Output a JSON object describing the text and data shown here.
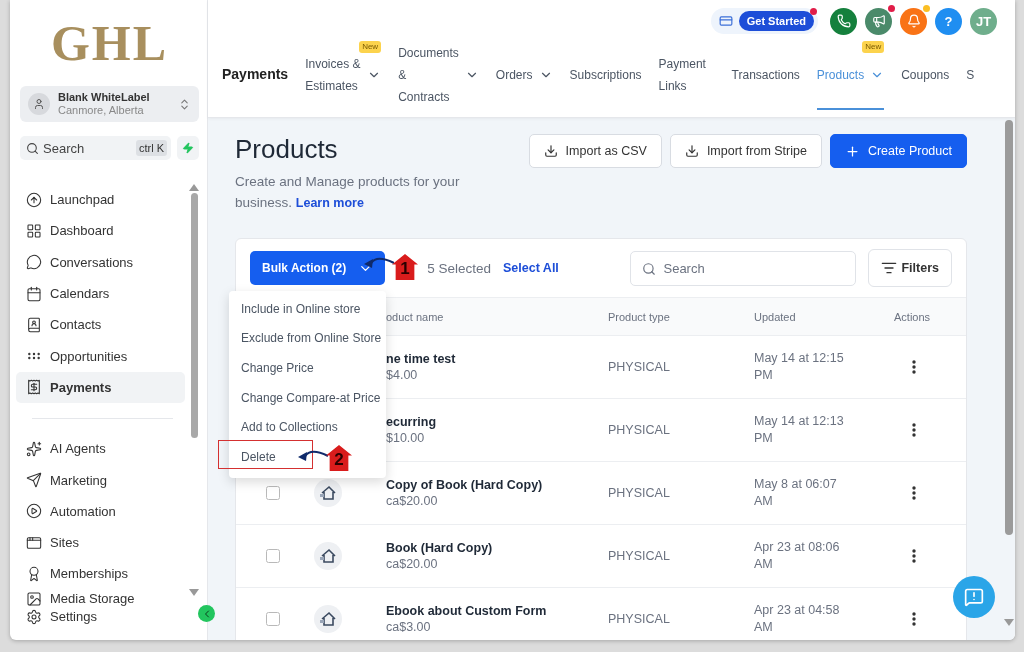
{
  "sidebar": {
    "logo": "GHL",
    "account": {
      "name": "Blank WhiteLabel",
      "location": "Canmore, Alberta"
    },
    "search": {
      "placeholder": "Search",
      "shortcut": "ctrl K"
    },
    "items": [
      {
        "label": "Launchpad",
        "selected": false
      },
      {
        "label": "Dashboard",
        "selected": false
      },
      {
        "label": "Conversations",
        "selected": false
      },
      {
        "label": "Calendars",
        "selected": false
      },
      {
        "label": "Contacts",
        "selected": false
      },
      {
        "label": "Opportunities",
        "selected": false
      },
      {
        "label": "Payments",
        "selected": true
      }
    ],
    "items_lower": [
      {
        "label": "AI Agents",
        "selected": false
      },
      {
        "label": "Marketing",
        "selected": false
      },
      {
        "label": "Automation",
        "selected": false
      },
      {
        "label": "Sites",
        "selected": false
      },
      {
        "label": "Memberships",
        "selected": false
      },
      {
        "label": "Media Storage",
        "selected": false
      }
    ],
    "settings": "Settings"
  },
  "header": {
    "get_started": {
      "label": "Get Started",
      "notification": true
    },
    "top_buttons": [
      {
        "kind": "phone",
        "notification": false
      },
      {
        "kind": "megaphone",
        "notification": true
      },
      {
        "kind": "bell",
        "notification": true
      },
      {
        "kind": "help",
        "label": "?",
        "notification": false
      },
      {
        "kind": "avatar",
        "label": "JT",
        "notification": false
      }
    ],
    "title": "Payments",
    "tabs": [
      {
        "label": "Invoices & Estimates",
        "badge": "New",
        "dropdown": true,
        "selected": false
      },
      {
        "label": "Documents & Contracts",
        "dropdown": true,
        "selected": false
      },
      {
        "label": "Orders",
        "dropdown": true,
        "selected": false
      },
      {
        "label": "Subscriptions",
        "dropdown": false,
        "selected": false
      },
      {
        "label": "Payment Links",
        "dropdown": false,
        "selected": false
      },
      {
        "label": "Transactions",
        "dropdown": false,
        "selected": false
      },
      {
        "label": "Products",
        "badge": "New",
        "dropdown": true,
        "selected": true
      },
      {
        "label": "Coupons",
        "dropdown": false,
        "selected": false
      },
      {
        "label": "S",
        "dropdown": false,
        "selected": false
      }
    ]
  },
  "page": {
    "title": "Products",
    "subtitle": "Create and Manage products for your business.",
    "link": "Learn more",
    "actions": [
      {
        "kind": "import",
        "label": "Import as CSV"
      },
      {
        "kind": "import",
        "label": "Import from Stripe"
      },
      {
        "kind": "primary",
        "label": "Create Product"
      }
    ]
  },
  "toolbar": {
    "bulk_action": "Bulk Action (2)",
    "selected_count": "5 Selected",
    "select_all": "Select All",
    "search": {
      "placeholder": "Search"
    },
    "filters": "Filters"
  },
  "bulk_menu": [
    "Include in Online store",
    "Exclude from Online Store",
    "Change Price",
    "Change Compare-at Price",
    "Add to Collections",
    "Delete"
  ],
  "annotations": [
    {
      "number": "1"
    },
    {
      "number": "2"
    }
  ],
  "table": {
    "columns": [
      "oduct name",
      "Product type",
      "Updated",
      "Actions"
    ],
    "rows": [
      {
        "name": "ne time test",
        "price": "$4.00",
        "type": "PHYSICAL",
        "updated": "May 14 at 12:15 PM"
      },
      {
        "name": "ecurring",
        "price": "$10.00",
        "type": "PHYSICAL",
        "updated": "May 14 at 12:13 PM"
      },
      {
        "checked": false,
        "name": "Copy of Book (Hard Copy)",
        "price": "ca$20.00",
        "type": "PHYSICAL",
        "updated": "May 8 at 06:07 AM"
      },
      {
        "checked": false,
        "name": "Book (Hard Copy)",
        "price": "ca$20.00",
        "type": "PHYSICAL",
        "updated": "Apr 23 at 08:06 AM"
      },
      {
        "checked": false,
        "name": "Ebook about Custom Form",
        "price": "ca$3.00",
        "type": "PHYSICAL",
        "updated": "Apr 23 at 04:58 AM"
      }
    ]
  }
}
